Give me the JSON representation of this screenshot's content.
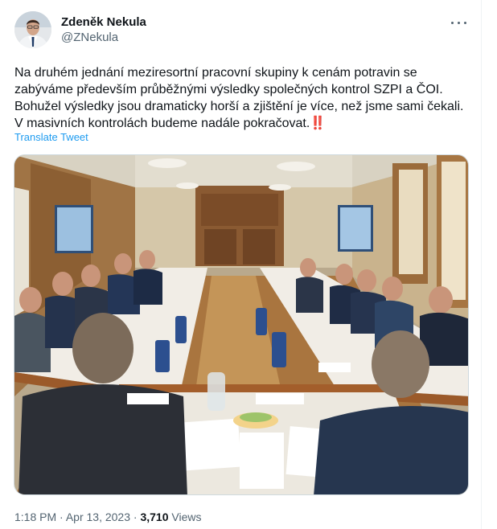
{
  "author": {
    "display_name": "Zdeněk Nekula",
    "handle": "@ZNekula"
  },
  "tweet": {
    "text": "Na druhém jednání meziresortní pracovní skupiny k cenám potravin se zabýváme především průběžnými výsledky společných kontrol SZPI a ČOI.  Bohužel výsledky jsou dramaticky horší a zjištění je více, než jsme sami čekali. V masivních kontrolách budeme nadále pokračovat.",
    "emoji": "‼️",
    "translate_label": "Translate Tweet",
    "photo_icon": "meeting-room-photo"
  },
  "meta": {
    "time": "1:18 PM",
    "separator": "·",
    "date": "Apr 13, 2023",
    "views_count": "3,710",
    "views_label": "Views"
  },
  "icons": {
    "more": "more-dots-icon"
  },
  "colors": {
    "link": "#1d9bf0",
    "secondary_text": "#536471",
    "primary_text": "#0f1419"
  }
}
